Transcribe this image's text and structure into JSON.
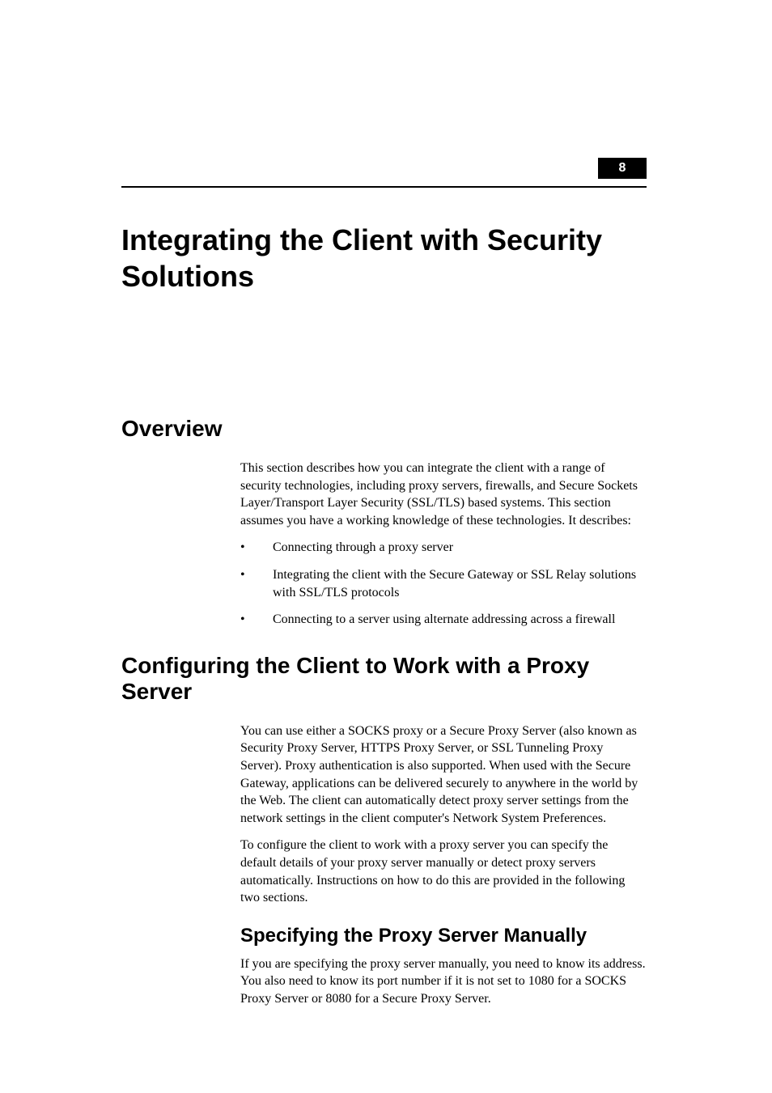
{
  "chapter": {
    "number": "8",
    "title": "Integrating the Client with Security Solutions"
  },
  "sections": {
    "overview": {
      "heading": "Overview",
      "para1": "This section describes how you can integrate the client with a range of security technologies, including proxy servers, firewalls, and Secure Sockets Layer/Transport Layer Security (SSL/TLS) based systems. This section assumes you have a working knowledge of these technologies. It describes:",
      "bullets": [
        "Connecting through a proxy server",
        "Integrating the client with the Secure Gateway or SSL Relay solutions with SSL/TLS protocols",
        "Connecting to a server using alternate addressing across a firewall"
      ]
    },
    "proxy": {
      "heading": "Configuring the Client to Work with a Proxy Server",
      "para1": "You can use either a SOCKS proxy or a Secure Proxy Server (also known as Security Proxy Server, HTTPS Proxy Server, or SSL Tunneling Proxy Server). Proxy authentication is also supported. When used with the Secure Gateway, applications can be delivered securely to anywhere in the world by the Web. The client can automatically detect proxy server settings from the network settings in the client computer's Network System Preferences.",
      "para2": "To configure the client to work with a proxy server you can specify the default details of your proxy server manually or detect proxy servers automatically. Instructions on how to do this are provided in the following two sections.",
      "subheading": "Specifying the Proxy Server Manually",
      "para3": "If you are specifying the proxy server manually, you need to know its address. You also need to know its port number if it is not set to 1080 for a SOCKS Proxy Server or 8080 for a Secure Proxy Server."
    }
  }
}
